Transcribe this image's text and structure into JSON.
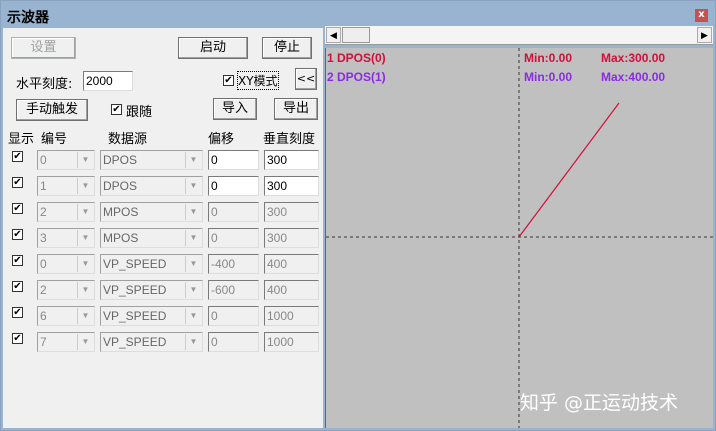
{
  "window": {
    "title": "示波器",
    "close": "x"
  },
  "controls": {
    "settings": "设置",
    "start": "启动",
    "stop": "停止",
    "h_scale_label": "水平刻度:",
    "h_scale_value": "2000",
    "xy_mode": "XY模式",
    "xy_checked": true,
    "collapse": "<<",
    "manual_trigger": "手动触发",
    "follow": "跟随",
    "follow_checked": true,
    "import": "导入",
    "export": "导出"
  },
  "columns": [
    "显示",
    "编号",
    "数据源",
    "偏移",
    "垂直刻度"
  ],
  "rows": [
    {
      "show": true,
      "num": "0",
      "source": "DPOS",
      "offset": "0",
      "scale": "300",
      "enabled": true
    },
    {
      "show": true,
      "num": "1",
      "source": "DPOS",
      "offset": "0",
      "scale": "300",
      "enabled": true
    },
    {
      "show": true,
      "num": "2",
      "source": "MPOS",
      "offset": "0",
      "scale": "300",
      "enabled": false
    },
    {
      "show": true,
      "num": "3",
      "source": "MPOS",
      "offset": "0",
      "scale": "300",
      "enabled": false
    },
    {
      "show": true,
      "num": "0",
      "source": "VP_SPEED",
      "offset": "-400",
      "scale": "400",
      "enabled": false
    },
    {
      "show": true,
      "num": "2",
      "source": "VP_SPEED",
      "offset": "-600",
      "scale": "400",
      "enabled": false
    },
    {
      "show": true,
      "num": "6",
      "source": "VP_SPEED",
      "offset": "0",
      "scale": "1000",
      "enabled": false
    },
    {
      "show": true,
      "num": "7",
      "source": "VP_SPEED",
      "offset": "0",
      "scale": "1000",
      "enabled": false
    }
  ],
  "plot": {
    "legend": [
      {
        "name": "1 DPOS(0)",
        "min": "Min:0.00",
        "max": "Max:300.00",
        "color": "#d0103a"
      },
      {
        "name": "2 DPOS(1)",
        "min": "Min:0.00",
        "max": "Max:400.00",
        "color": "#8a2be2"
      }
    ],
    "trace_color": "#d0103a",
    "trace": {
      "x": [
        0,
        300
      ],
      "y": [
        0,
        400
      ]
    }
  },
  "watermark": "知乎 @正运动技术"
}
